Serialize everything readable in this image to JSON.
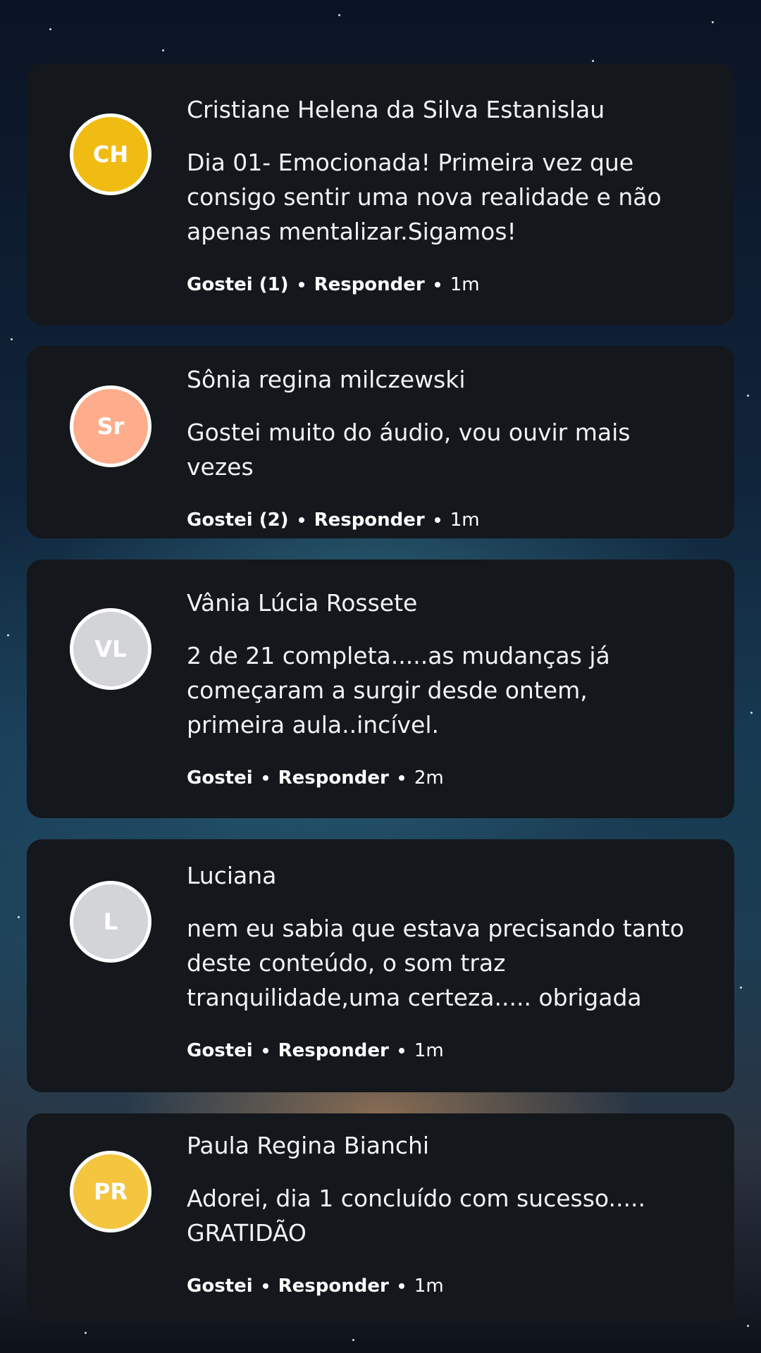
{
  "comments": [
    {
      "initials": "CH",
      "avatar_color": "#f0bc14",
      "author": "Cristiane Helena da Silva Estanislau",
      "text": "Dia 01- Emocionada! Primeira vez que consigo sentir uma nova realidade e não apenas mentalizar.Sigamos!",
      "like_label": "Gostei (1)",
      "reply_label": "Responder",
      "time": "1m"
    },
    {
      "initials": "Sr",
      "avatar_color": "#fdad8b",
      "author": "Sônia regina milczewski",
      "text": "Gostei muito do áudio, vou ouvir mais vezes",
      "like_label": "Gostei (2)",
      "reply_label": "Responder",
      "time": "1m"
    },
    {
      "initials": "VL",
      "avatar_color": "#d2d4d8",
      "author": "Vânia Lúcia Rossete",
      "text": "2 de 21 completa.....as mudanças já começaram a surgir desde ontem, primeira aula..incível.",
      "like_label": "Gostei",
      "reply_label": "Responder",
      "time": "2m"
    },
    {
      "initials": "L",
      "avatar_color": "#d2d4d8",
      "author": "Luciana",
      "text": "nem eu sabia que estava precisando tanto deste conteúdo, o som  traz tranquilidade,uma certeza..... obrigada",
      "like_label": "Gostei",
      "reply_label": "Responder",
      "time": "1m"
    },
    {
      "initials": "PR",
      "avatar_color": "#f4c53f",
      "author": "Paula Regina Bianchi",
      "text": "Adorei, dia 1 concluído com sucesso..... GRATIDÃO",
      "like_label": "Gostei",
      "reply_label": "Responder",
      "time": "1m"
    }
  ]
}
